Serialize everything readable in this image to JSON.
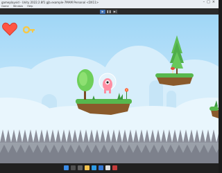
{
  "window": {
    "title": "gameplayvid - Unity 2022.2.8f1 gjb.example-7MAM Personal <DX11>",
    "menu": [
      "Game",
      "Window",
      "Help"
    ]
  },
  "toolbar": {
    "play_icon": "play-icon",
    "pause_icon": "pause-icon",
    "step_icon": "step-icon"
  },
  "hud": {
    "heart_icon": "heart-icon",
    "key_icon": "key-icon"
  },
  "taskbar": {
    "icons": [
      "windows-start-icon",
      "search-icon",
      "task-view-icon",
      "file-explorer-icon",
      "browser-icon",
      "store-icon",
      "unity-icon",
      "app-icon"
    ],
    "tray_time": "",
    "tray_date": ""
  },
  "colors": {
    "sky_top": "#9fd6f6",
    "grass": "#57b84e",
    "dirt": "#8a5a2b",
    "heart": "#ff5544",
    "key": "#f5c84a",
    "spikes": "#8c8f9a",
    "player": "#ff8fa3"
  }
}
